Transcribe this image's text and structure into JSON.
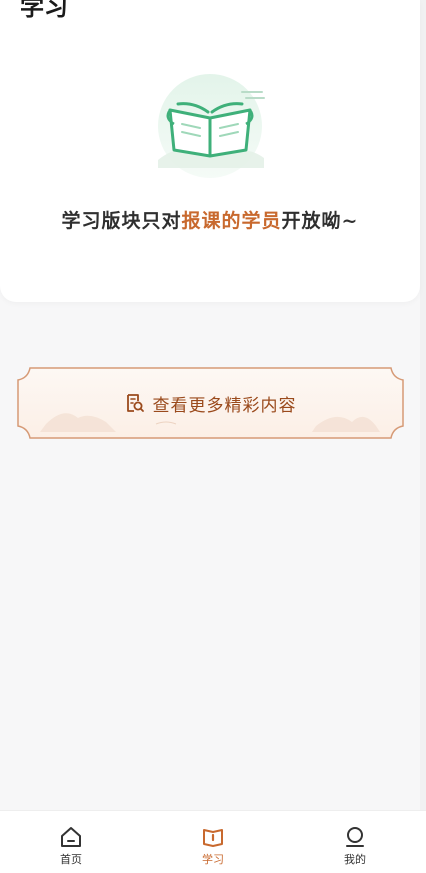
{
  "header": {
    "title": "学习"
  },
  "empty_state": {
    "message_prefix": "学习版块只对",
    "message_accent": "报课的学员",
    "message_suffix": "开放呦~"
  },
  "more_button": {
    "label": "查看更多精彩内容",
    "icon": "search-document-icon"
  },
  "tabbar": {
    "items": [
      {
        "label": "首页",
        "icon": "home-icon"
      },
      {
        "label": "学习",
        "icon": "study-book-icon"
      },
      {
        "label": "我的",
        "icon": "profile-icon"
      }
    ],
    "active_index": 1
  },
  "colors": {
    "accent": "#c8692e",
    "illustration_green": "#49b27f",
    "background": "#f7f7f8"
  }
}
